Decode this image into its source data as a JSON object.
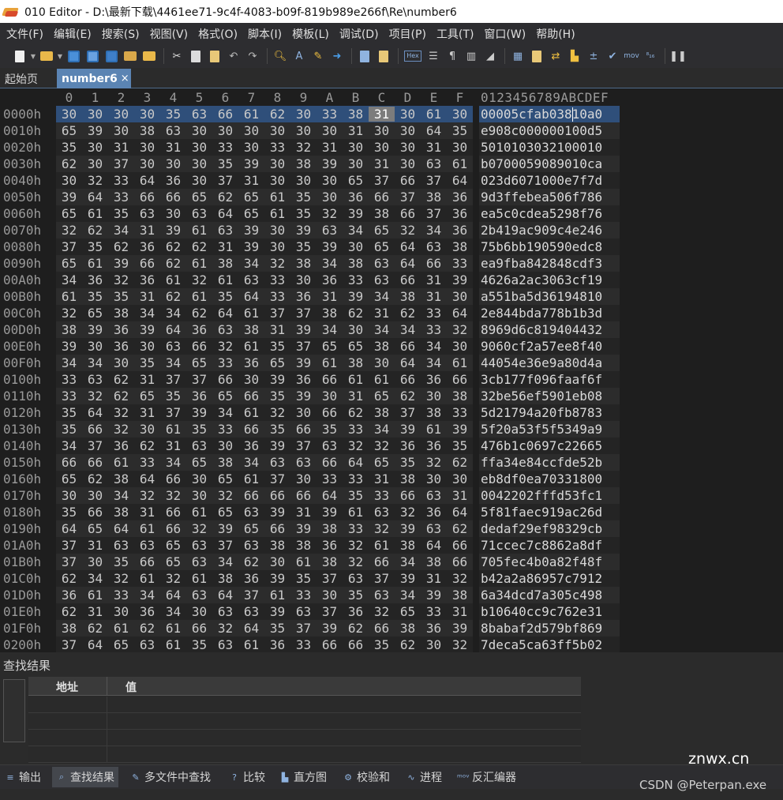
{
  "window": {
    "title": "010 Editor - D:\\最新下载\\4461ee71-9c4f-4083-b09f-819b989e266f\\Re\\number6"
  },
  "menu": [
    "文件(F)",
    "编辑(E)",
    "搜索(S)",
    "视图(V)",
    "格式(O)",
    "脚本(I)",
    "模板(L)",
    "调试(D)",
    "项目(P)",
    "工具(T)",
    "窗口(W)",
    "帮助(H)"
  ],
  "toolbar": {
    "hex_label": "Hex",
    "mov_label": "mov"
  },
  "tabs": {
    "start": "起始页",
    "active": "number6",
    "close": "×"
  },
  "hex": {
    "col_headers": [
      "0",
      "1",
      "2",
      "3",
      "4",
      "5",
      "6",
      "7",
      "8",
      "9",
      "A",
      "B",
      "C",
      "D",
      "E",
      "F"
    ],
    "ascii_header": "0123456789ABCDEF",
    "selected_row": 0,
    "cursor_col": 12,
    "rows": [
      {
        "addr": "0000h",
        "bytes": [
          "30",
          "30",
          "30",
          "30",
          "35",
          "63",
          "66",
          "61",
          "62",
          "30",
          "33",
          "38",
          "31",
          "30",
          "61",
          "30"
        ],
        "ascii": "00005cfab03810a0"
      },
      {
        "addr": "0010h",
        "bytes": [
          "65",
          "39",
          "30",
          "38",
          "63",
          "30",
          "30",
          "30",
          "30",
          "30",
          "30",
          "31",
          "30",
          "30",
          "64",
          "35"
        ],
        "ascii": "e908c000000100d5"
      },
      {
        "addr": "0020h",
        "bytes": [
          "35",
          "30",
          "31",
          "30",
          "31",
          "30",
          "33",
          "30",
          "33",
          "32",
          "31",
          "30",
          "30",
          "30",
          "31",
          "30"
        ],
        "ascii": "5010103032100010"
      },
      {
        "addr": "0030h",
        "bytes": [
          "62",
          "30",
          "37",
          "30",
          "30",
          "30",
          "35",
          "39",
          "30",
          "38",
          "39",
          "30",
          "31",
          "30",
          "63",
          "61"
        ],
        "ascii": "b0700059089010ca"
      },
      {
        "addr": "0040h",
        "bytes": [
          "30",
          "32",
          "33",
          "64",
          "36",
          "30",
          "37",
          "31",
          "30",
          "30",
          "30",
          "65",
          "37",
          "66",
          "37",
          "64"
        ],
        "ascii": "023d6071000e7f7d"
      },
      {
        "addr": "0050h",
        "bytes": [
          "39",
          "64",
          "33",
          "66",
          "66",
          "65",
          "62",
          "65",
          "61",
          "35",
          "30",
          "36",
          "66",
          "37",
          "38",
          "36"
        ],
        "ascii": "9d3ffebea506f786"
      },
      {
        "addr": "0060h",
        "bytes": [
          "65",
          "61",
          "35",
          "63",
          "30",
          "63",
          "64",
          "65",
          "61",
          "35",
          "32",
          "39",
          "38",
          "66",
          "37",
          "36"
        ],
        "ascii": "ea5c0cdea5298f76"
      },
      {
        "addr": "0070h",
        "bytes": [
          "32",
          "62",
          "34",
          "31",
          "39",
          "61",
          "63",
          "39",
          "30",
          "39",
          "63",
          "34",
          "65",
          "32",
          "34",
          "36"
        ],
        "ascii": "2b419ac909c4e246"
      },
      {
        "addr": "0080h",
        "bytes": [
          "37",
          "35",
          "62",
          "36",
          "62",
          "62",
          "31",
          "39",
          "30",
          "35",
          "39",
          "30",
          "65",
          "64",
          "63",
          "38"
        ],
        "ascii": "75b6bb190590edc8"
      },
      {
        "addr": "0090h",
        "bytes": [
          "65",
          "61",
          "39",
          "66",
          "62",
          "61",
          "38",
          "34",
          "32",
          "38",
          "34",
          "38",
          "63",
          "64",
          "66",
          "33"
        ],
        "ascii": "ea9fba842848cdf3"
      },
      {
        "addr": "00A0h",
        "bytes": [
          "34",
          "36",
          "32",
          "36",
          "61",
          "32",
          "61",
          "63",
          "33",
          "30",
          "36",
          "33",
          "63",
          "66",
          "31",
          "39"
        ],
        "ascii": "4626a2ac3063cf19"
      },
      {
        "addr": "00B0h",
        "bytes": [
          "61",
          "35",
          "35",
          "31",
          "62",
          "61",
          "35",
          "64",
          "33",
          "36",
          "31",
          "39",
          "34",
          "38",
          "31",
          "30"
        ],
        "ascii": "a551ba5d36194810"
      },
      {
        "addr": "00C0h",
        "bytes": [
          "32",
          "65",
          "38",
          "34",
          "34",
          "62",
          "64",
          "61",
          "37",
          "37",
          "38",
          "62",
          "31",
          "62",
          "33",
          "64"
        ],
        "ascii": "2e844bda778b1b3d"
      },
      {
        "addr": "00D0h",
        "bytes": [
          "38",
          "39",
          "36",
          "39",
          "64",
          "36",
          "63",
          "38",
          "31",
          "39",
          "34",
          "30",
          "34",
          "34",
          "33",
          "32"
        ],
        "ascii": "8969d6c819404432"
      },
      {
        "addr": "00E0h",
        "bytes": [
          "39",
          "30",
          "36",
          "30",
          "63",
          "66",
          "32",
          "61",
          "35",
          "37",
          "65",
          "65",
          "38",
          "66",
          "34",
          "30"
        ],
        "ascii": "9060cf2a57ee8f40"
      },
      {
        "addr": "00F0h",
        "bytes": [
          "34",
          "34",
          "30",
          "35",
          "34",
          "65",
          "33",
          "36",
          "65",
          "39",
          "61",
          "38",
          "30",
          "64",
          "34",
          "61"
        ],
        "ascii": "44054e36e9a80d4a"
      },
      {
        "addr": "0100h",
        "bytes": [
          "33",
          "63",
          "62",
          "31",
          "37",
          "37",
          "66",
          "30",
          "39",
          "36",
          "66",
          "61",
          "61",
          "66",
          "36",
          "66"
        ],
        "ascii": "3cb177f096faaf6f"
      },
      {
        "addr": "0110h",
        "bytes": [
          "33",
          "32",
          "62",
          "65",
          "35",
          "36",
          "65",
          "66",
          "35",
          "39",
          "30",
          "31",
          "65",
          "62",
          "30",
          "38"
        ],
        "ascii": "32be56ef5901eb08"
      },
      {
        "addr": "0120h",
        "bytes": [
          "35",
          "64",
          "32",
          "31",
          "37",
          "39",
          "34",
          "61",
          "32",
          "30",
          "66",
          "62",
          "38",
          "37",
          "38",
          "33"
        ],
        "ascii": "5d21794a20fb8783"
      },
      {
        "addr": "0130h",
        "bytes": [
          "35",
          "66",
          "32",
          "30",
          "61",
          "35",
          "33",
          "66",
          "35",
          "66",
          "35",
          "33",
          "34",
          "39",
          "61",
          "39"
        ],
        "ascii": "5f20a53f5f5349a9"
      },
      {
        "addr": "0140h",
        "bytes": [
          "34",
          "37",
          "36",
          "62",
          "31",
          "63",
          "30",
          "36",
          "39",
          "37",
          "63",
          "32",
          "32",
          "36",
          "36",
          "35"
        ],
        "ascii": "476b1c0697c22665"
      },
      {
        "addr": "0150h",
        "bytes": [
          "66",
          "66",
          "61",
          "33",
          "34",
          "65",
          "38",
          "34",
          "63",
          "63",
          "66",
          "64",
          "65",
          "35",
          "32",
          "62"
        ],
        "ascii": "ffa34e84ccfde52b"
      },
      {
        "addr": "0160h",
        "bytes": [
          "65",
          "62",
          "38",
          "64",
          "66",
          "30",
          "65",
          "61",
          "37",
          "30",
          "33",
          "33",
          "31",
          "38",
          "30",
          "30"
        ],
        "ascii": "eb8df0ea70331800"
      },
      {
        "addr": "0170h",
        "bytes": [
          "30",
          "30",
          "34",
          "32",
          "32",
          "30",
          "32",
          "66",
          "66",
          "66",
          "64",
          "35",
          "33",
          "66",
          "63",
          "31"
        ],
        "ascii": "0042202fffd53fc1"
      },
      {
        "addr": "0180h",
        "bytes": [
          "35",
          "66",
          "38",
          "31",
          "66",
          "61",
          "65",
          "63",
          "39",
          "31",
          "39",
          "61",
          "63",
          "32",
          "36",
          "64"
        ],
        "ascii": "5f81faec919ac26d"
      },
      {
        "addr": "0190h",
        "bytes": [
          "64",
          "65",
          "64",
          "61",
          "66",
          "32",
          "39",
          "65",
          "66",
          "39",
          "38",
          "33",
          "32",
          "39",
          "63",
          "62"
        ],
        "ascii": "dedaf29ef98329cb"
      },
      {
        "addr": "01A0h",
        "bytes": [
          "37",
          "31",
          "63",
          "63",
          "65",
          "63",
          "37",
          "63",
          "38",
          "38",
          "36",
          "32",
          "61",
          "38",
          "64",
          "66"
        ],
        "ascii": "71ccec7c8862a8df"
      },
      {
        "addr": "01B0h",
        "bytes": [
          "37",
          "30",
          "35",
          "66",
          "65",
          "63",
          "34",
          "62",
          "30",
          "61",
          "38",
          "32",
          "66",
          "34",
          "38",
          "66"
        ],
        "ascii": "705fec4b0a82f48f"
      },
      {
        "addr": "01C0h",
        "bytes": [
          "62",
          "34",
          "32",
          "61",
          "32",
          "61",
          "38",
          "36",
          "39",
          "35",
          "37",
          "63",
          "37",
          "39",
          "31",
          "32"
        ],
        "ascii": "b42a2a86957c7912"
      },
      {
        "addr": "01D0h",
        "bytes": [
          "36",
          "61",
          "33",
          "34",
          "64",
          "63",
          "64",
          "37",
          "61",
          "33",
          "30",
          "35",
          "63",
          "34",
          "39",
          "38"
        ],
        "ascii": "6a34dcd7a305c498"
      },
      {
        "addr": "01E0h",
        "bytes": [
          "62",
          "31",
          "30",
          "36",
          "34",
          "30",
          "63",
          "63",
          "39",
          "63",
          "37",
          "36",
          "32",
          "65",
          "33",
          "31"
        ],
        "ascii": "b10640cc9c762e31"
      },
      {
        "addr": "01F0h",
        "bytes": [
          "38",
          "62",
          "61",
          "62",
          "61",
          "66",
          "32",
          "64",
          "35",
          "37",
          "39",
          "62",
          "66",
          "38",
          "36",
          "39"
        ],
        "ascii": "8babaf2d579bf869"
      },
      {
        "addr": "0200h",
        "bytes": [
          "37",
          "64",
          "65",
          "63",
          "61",
          "35",
          "63",
          "61",
          "36",
          "33",
          "66",
          "66",
          "35",
          "62",
          "30",
          "32"
        ],
        "ascii": "7deca5ca63ff5b02"
      }
    ]
  },
  "find_results": {
    "title": "查找结果",
    "columns": [
      "地址",
      "值"
    ],
    "rows": []
  },
  "bottom_tabs": [
    {
      "label": "输出",
      "icon": "output-icon",
      "active": false
    },
    {
      "label": "查找结果",
      "icon": "find-results-icon",
      "active": true
    },
    {
      "label": "多文件中查找",
      "icon": "find-in-files-icon",
      "active": false
    },
    {
      "label": "比较",
      "icon": "compare-icon",
      "active": false
    },
    {
      "label": "直方图",
      "icon": "histogram-icon",
      "active": false
    },
    {
      "label": "校验和",
      "icon": "checksum-icon",
      "active": false
    },
    {
      "label": "进程",
      "icon": "process-icon",
      "active": false
    },
    {
      "label": "反汇编器",
      "icon": "disassembler-icon",
      "active": false
    }
  ],
  "watermark": {
    "site": "znwx.cn",
    "credit": "CSDN @Peterpan.exe"
  }
}
